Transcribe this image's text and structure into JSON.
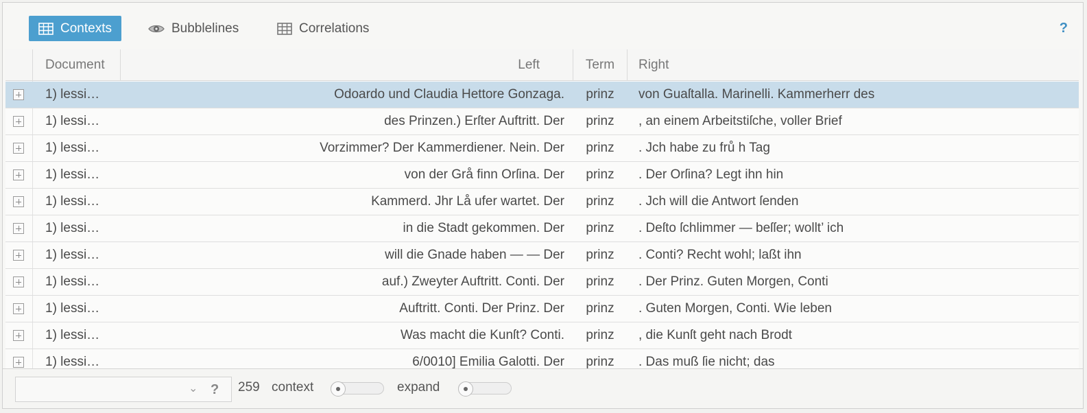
{
  "toolbar": {
    "tabs": [
      {
        "label": "Contexts",
        "icon": "table-icon",
        "active": true
      },
      {
        "label": "Bubblelines",
        "icon": "eye-icon",
        "active": false
      },
      {
        "label": "Correlations",
        "icon": "table-icon",
        "active": false
      }
    ],
    "help": "?"
  },
  "grid": {
    "columns": [
      "Document",
      "Left",
      "Term",
      "Right"
    ],
    "rows": [
      {
        "doc": "1) lessi…",
        "left": "Odoardo und Claudia Hettore Gonzaga.",
        "term": "prinz",
        "right": "von Guaſtalla. Marinelli. Kammerherr des",
        "selected": true
      },
      {
        "doc": "1) lessi…",
        "left": "des Prinzen.) Erſter Auftritt. Der",
        "term": "prinz",
        "right": ", an einem Arbeitstiſche, voller Brief"
      },
      {
        "doc": "1) lessi…",
        "left": "Vorzimmer? Der Kammerdiener. Nein. Der",
        "term": "prinz",
        "right": ". Jch habe zu frů h Tag"
      },
      {
        "doc": "1) lessi…",
        "left": "von der Grå finn Orſina. Der",
        "term": "prinz",
        "right": ". Der Orſina? Legt ihn hin"
      },
      {
        "doc": "1) lessi…",
        "left": "Kammerd. Jhr Lå ufer wartet. Der",
        "term": "prinz",
        "right": ". Jch will die Antwort ſenden"
      },
      {
        "doc": "1) lessi…",
        "left": "in die Stadt gekommen. Der",
        "term": "prinz",
        "right": ". Deſto ſchlimmer — beſſer; wollt’ ich"
      },
      {
        "doc": "1) lessi…",
        "left": "will die Gnade haben — — Der",
        "term": "prinz",
        "right": ". Conti? Recht wohl; laßt ihn"
      },
      {
        "doc": "1) lessi…",
        "left": "auf.) Zweyter Auftritt. Conti. Der",
        "term": "prinz",
        "right": ". Der Prinz. Guten Morgen, Conti"
      },
      {
        "doc": "1) lessi…",
        "left": "Auftritt. Conti. Der Prinz. Der",
        "term": "prinz",
        "right": ". Guten Morgen, Conti. Wie leben"
      },
      {
        "doc": "1) lessi…",
        "left": "Was macht die Kunſt? Conti.",
        "term": "prinz",
        "right": ", die Kunſt geht nach Brodt"
      },
      {
        "doc": "1) lessi…",
        "left": "6/0010] Emilia Galotti. Der",
        "term": "prinz",
        "right": ". Das muß ſie nicht; das"
      }
    ]
  },
  "footer": {
    "combo_value": "",
    "help": "?",
    "count": "259",
    "context_label": "context",
    "expand_label": "expand",
    "context_level": 0,
    "expand_level": 0
  },
  "colors": {
    "accent": "#4c9fcf",
    "selected_row": "#c8dcea"
  }
}
